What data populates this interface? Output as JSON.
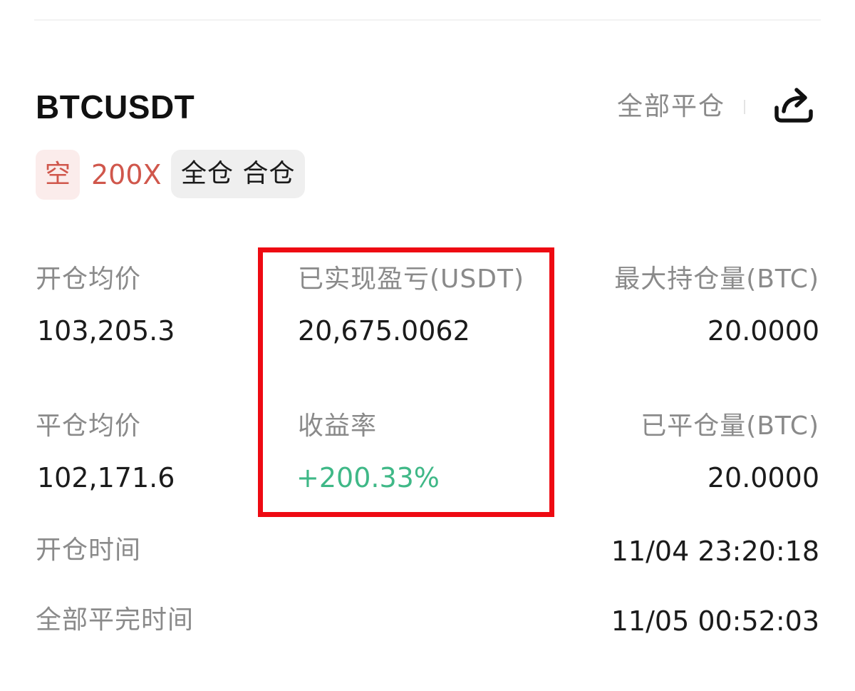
{
  "header": {
    "symbol": "BTCUSDT",
    "close_all_label": "全部平仓",
    "share_icon": "share-icon"
  },
  "tags": {
    "direction": "空",
    "leverage": "200X",
    "margin_mode": "全仓 合仓"
  },
  "stats": {
    "open_avg_price": {
      "label": "开仓均价",
      "value": "103,205.3"
    },
    "realized_pnl": {
      "label": "已实现盈亏(USDT)",
      "value": "20,675.0062"
    },
    "max_position": {
      "label": "最大持仓量(BTC)",
      "value": "20.0000"
    },
    "close_avg_price": {
      "label": "平仓均价",
      "value": "102,171.6"
    },
    "roi": {
      "label": "收益率",
      "value": "+200.33%"
    },
    "closed_volume": {
      "label": "已平仓量(BTC)",
      "value": "20.0000"
    }
  },
  "times": {
    "open_time": {
      "label": "开仓时间",
      "value": "11/04 23:20:18"
    },
    "full_close_time": {
      "label": "全部平完时间",
      "value": "11/05 00:52:03"
    }
  },
  "colors": {
    "short": "#d0574c",
    "profit": "#3fb887",
    "highlight": "#ee0a12",
    "muted_text": "#8a8a8a"
  }
}
